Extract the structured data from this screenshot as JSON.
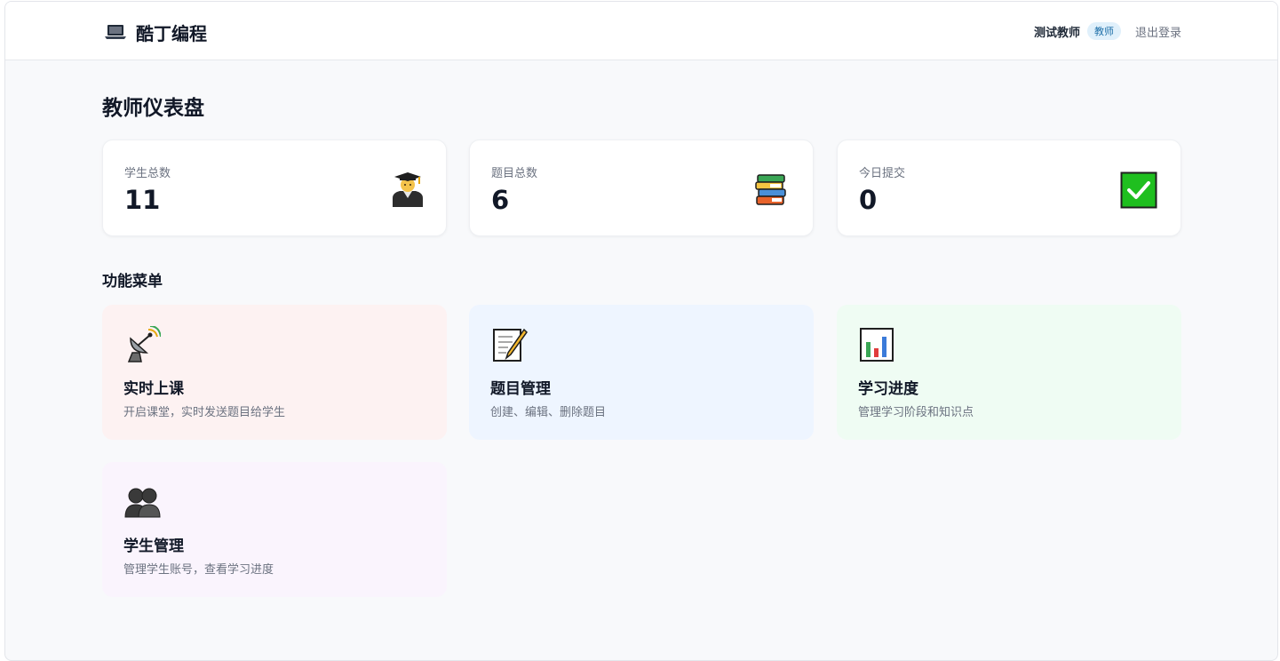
{
  "header": {
    "brand_icon": "laptop-icon",
    "brand_title": "酷丁编程",
    "user_name": "测试教师",
    "role_badge": "教师",
    "logout_label": "退出登录"
  },
  "page_title": "教师仪表盘",
  "stats": [
    {
      "label": "学生总数",
      "value": "11",
      "icon": "student-graduate-icon"
    },
    {
      "label": "题目总数",
      "value": "6",
      "icon": "books-icon"
    },
    {
      "label": "今日提交",
      "value": "0",
      "icon": "check-mark-icon"
    }
  ],
  "menu_section_title": "功能菜单",
  "menu": [
    {
      "title": "实时上课",
      "desc": "开启课堂，实时发送题目给学生",
      "icon": "satellite-antenna-icon",
      "bg": "#fdf2f2"
    },
    {
      "title": "题目管理",
      "desc": "创建、编辑、删除题目",
      "icon": "memo-icon",
      "bg": "#eef5ff"
    },
    {
      "title": "学习进度",
      "desc": "管理学习阶段和知识点",
      "icon": "bar-chart-icon",
      "bg": "#effcf3"
    },
    {
      "title": "学生管理",
      "desc": "管理学生账号，查看学习进度",
      "icon": "people-icon",
      "bg": "#faf4fd"
    }
  ],
  "colors": {
    "page_bg": "#f8f9fb",
    "badge_bg": "#e0f0fb",
    "badge_text": "#1e6fa8",
    "check_green": "#1fbf1f"
  }
}
